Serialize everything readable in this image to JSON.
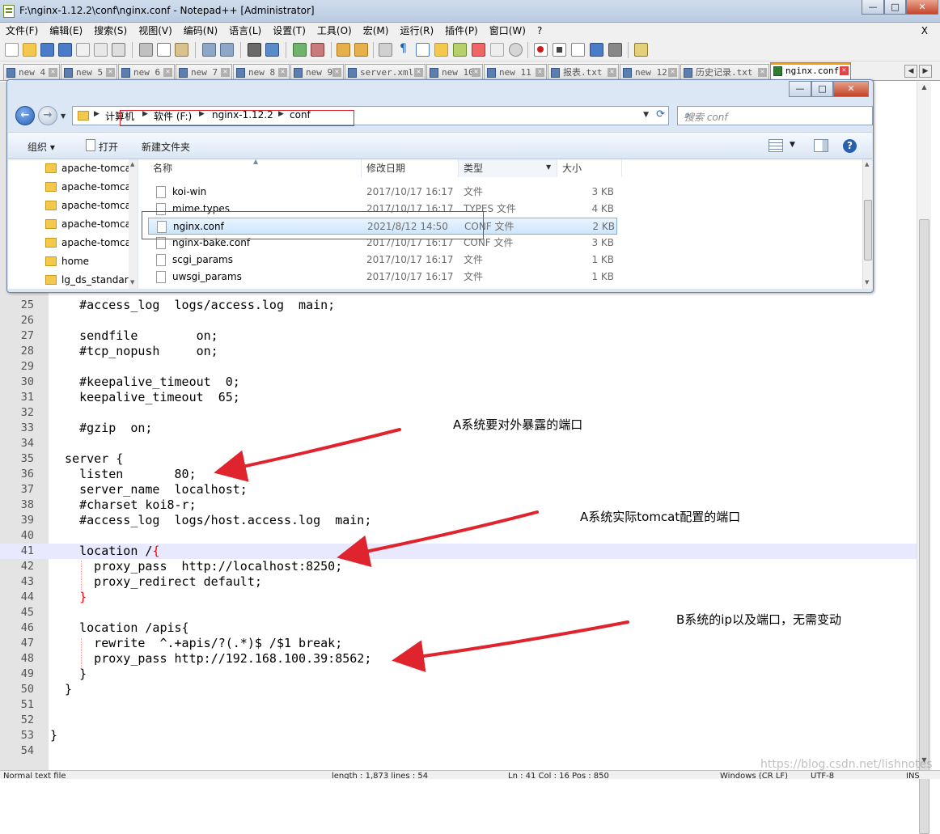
{
  "window": {
    "title": "F:\\nginx-1.12.2\\conf\\nginx.conf - Notepad++ [Administrator]",
    "minimize": "—",
    "maximize": "□",
    "close": "✕"
  },
  "menu": {
    "items": [
      "文件(F)",
      "编辑(E)",
      "搜索(S)",
      "视图(V)",
      "编码(N)",
      "语言(L)",
      "设置(T)",
      "工具(O)",
      "宏(M)",
      "运行(R)",
      "插件(P)",
      "窗口(W)",
      "?"
    ],
    "close": "X"
  },
  "tabs": [
    {
      "label": "new 4"
    },
    {
      "label": "new 5"
    },
    {
      "label": "new 6"
    },
    {
      "label": "new 7"
    },
    {
      "label": "new 8"
    },
    {
      "label": "new 9"
    },
    {
      "label": "server.xml"
    },
    {
      "label": "new 10"
    },
    {
      "label": "new 11"
    },
    {
      "label": "报表.txt"
    },
    {
      "label": "new 12"
    },
    {
      "label": "历史记录.txt"
    },
    {
      "label": "nginx.conf"
    }
  ],
  "tab_nav": {
    "left": "◀",
    "right": "▶"
  },
  "explorer": {
    "breadcrumb": [
      "计算机",
      "软件 (F:)",
      "nginx-1.12.2",
      "conf"
    ],
    "search_placeholder": "搜索 conf",
    "commands": {
      "organize": "组织 ▾",
      "open": "打开",
      "new_folder": "新建文件夹"
    },
    "nav_items": [
      "apache-tomca",
      "apache-tomca",
      "apache-tomca",
      "apache-tomca",
      "apache-tomca",
      "home",
      "lg_ds_standar"
    ],
    "columns": {
      "name": "名称",
      "date": "修改日期",
      "type": "类型",
      "size": "大小"
    },
    "files": [
      {
        "name": "koi-win",
        "date": "2017/10/17 16:17",
        "type": "文件",
        "size": "3 KB"
      },
      {
        "name": "mime.types",
        "date": "2017/10/17 16:17",
        "type": "TYPES 文件",
        "size": "4 KB"
      },
      {
        "name": "nginx.conf",
        "date": "2021/8/12 14:50",
        "type": "CONF 文件",
        "size": "2 KB"
      },
      {
        "name": "nginx-bake.conf",
        "date": "2017/10/17 16:17",
        "type": "CONF 文件",
        "size": "3 KB"
      },
      {
        "name": "scgi_params",
        "date": "2017/10/17 16:17",
        "type": "文件",
        "size": "1 KB"
      },
      {
        "name": "uwsgi_params",
        "date": "2017/10/17 16:17",
        "type": "文件",
        "size": "1 KB"
      }
    ],
    "selected_file": "nginx.conf"
  },
  "editor": {
    "current_line": 41,
    "lines": [
      {
        "n": "25",
        "code": "    #access_log  logs/access.log  main;"
      },
      {
        "n": "26",
        "code": ""
      },
      {
        "n": "27",
        "code": "    sendfile        on;"
      },
      {
        "n": "28",
        "code": "    #tcp_nopush     on;"
      },
      {
        "n": "29",
        "code": ""
      },
      {
        "n": "30",
        "code": "    #keepalive_timeout  0;"
      },
      {
        "n": "31",
        "code": "    keepalive_timeout  65;"
      },
      {
        "n": "32",
        "code": ""
      },
      {
        "n": "33",
        "code": "    #gzip  on;"
      },
      {
        "n": "34",
        "code": ""
      },
      {
        "n": "35",
        "code": "  server {"
      },
      {
        "n": "36",
        "code": "    listen       80;"
      },
      {
        "n": "37",
        "code": "    server_name  localhost;"
      },
      {
        "n": "38",
        "code": "    #charset koi8-r;"
      },
      {
        "n": "39",
        "code": "    #access_log  logs/host.access.log  main;"
      },
      {
        "n": "40",
        "code": ""
      },
      {
        "n": "41",
        "code": "    location /{"
      },
      {
        "n": "42",
        "code": "      proxy_pass  http://localhost:8250;"
      },
      {
        "n": "43",
        "code": "      proxy_redirect default;"
      },
      {
        "n": "44",
        "code": "    }"
      },
      {
        "n": "45",
        "code": ""
      },
      {
        "n": "46",
        "code": "    location /apis{"
      },
      {
        "n": "47",
        "code": "      rewrite  ^.+apis/?(.*)$ /$1 break;"
      },
      {
        "n": "48",
        "code": "      proxy_pass http://192.168.100.39:8562;"
      },
      {
        "n": "49",
        "code": "    }"
      },
      {
        "n": "50",
        "code": "  }"
      },
      {
        "n": "51",
        "code": ""
      },
      {
        "n": "52",
        "code": ""
      },
      {
        "n": "53",
        "code": "}"
      },
      {
        "n": "54",
        "code": ""
      }
    ]
  },
  "annotations": {
    "a_external_port": "A系统要对外暴露的端口",
    "a_tomcat_port": "A系统实际tomcat配置的端口",
    "b_ip_port": "B系统的ip以及端口，无需变动",
    "arrow_color": "#e0242e"
  },
  "statusbar": {
    "doc_type": "Normal text file",
    "length": "length : 1,873    lines : 54",
    "position": "Ln : 41    Col : 16    Pos : 850",
    "eol": "Windows (CR LF)",
    "encoding": "UTF-8",
    "mode": "INS"
  },
  "watermark": "https://blog.csdn.net/lishnotes"
}
